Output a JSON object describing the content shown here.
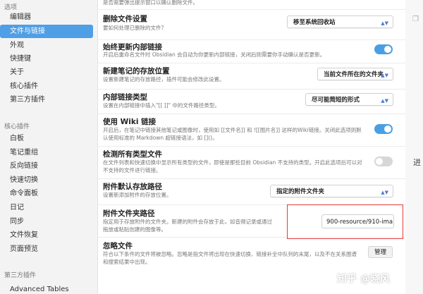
{
  "sidebar": {
    "header_options": "选项",
    "items_options": [
      {
        "label": "编辑器",
        "active": false
      },
      {
        "label": "文件与链接",
        "active": true
      },
      {
        "label": "外观",
        "active": false
      },
      {
        "label": "快捷键",
        "active": false
      },
      {
        "label": "关于",
        "active": false
      },
      {
        "label": "核心插件",
        "active": false
      },
      {
        "label": "第三方插件",
        "active": false
      }
    ],
    "header_core": "核心插件",
    "items_core": [
      "白板",
      "笔记重组",
      "反向链接",
      "快速切换",
      "命令面板",
      "日记",
      "同步",
      "文件恢复",
      "页面预览"
    ],
    "header_third": "第三方插件",
    "items_third": [
      "Advanced Tables"
    ]
  },
  "main": {
    "top_desc": "是否需要弹出提示窗口以确认删除文件。",
    "settings": [
      {
        "title": "删除文件设置",
        "desc": "要如何处理已删除的文件？",
        "control": "select",
        "value": "移至系统回收站"
      },
      {
        "title": "始终更新内部链接",
        "desc": "开启后重命名文件时 Obsidian 会自动为你更新内部链接，关闭后则需要你手动确认是否更新。",
        "control": "toggle",
        "value": "on"
      },
      {
        "title": "新建笔记的存放位置",
        "desc": "设置新建笔记的存放路径，插件可能会修改此设置。",
        "control": "select",
        "value": "当前文件所在的文件夹"
      },
      {
        "title": "内部链接类型",
        "desc": "设置在内部链接中插入\"[[ ]]\" 中的文件路径类型。",
        "control": "select",
        "value": "尽可能简短的形式"
      },
      {
        "title": "使用 Wiki 链接",
        "desc": "开启后，在笔记中链接其他笔记或图像时，使用如 [[文件名]] 和 ![[图片名]] 这样的Wiki链接。关闭此选项则默认使用标准的 Markdown 超链接语法，如 []()。",
        "control": "toggle",
        "value": "on"
      },
      {
        "title": "检测所有类型文件",
        "desc": "在文件列表和快速切换中显示所有类型的文件，即使是那些目前 Obsidian 不支持的类型。开启此选项后可以对不支持的文件进行链接。",
        "control": "toggle",
        "value": "off"
      },
      {
        "title": "附件默认存放路径",
        "desc": "设置新添加附件的存放位置。",
        "control": "select",
        "value": "指定的附件文件夹"
      },
      {
        "title": "附件文件夹路径",
        "desc": "指定用于存放附件的文件夹。新建的附件会存放于此，如音频记录或通过拖放或粘贴创建的图像等。",
        "control": "text",
        "value": "900-resource/910-ima"
      },
      {
        "title": "忽略文件",
        "desc": "符合以下条件的文件将被忽略。忽略是指文件将出现在快速切换、链接补全中队列的末尾，以及不在关系图谱和搜索结果中出现。",
        "control": "button",
        "value": "管理"
      }
    ]
  },
  "gutter": {
    "top_icon": "window-icon",
    "char": "进"
  },
  "watermark": "知乎 @晓风",
  "colors": {
    "accent": "#4f9fe6",
    "toggle_on": "#4a9fe4",
    "highlight_box": "#e23a3a"
  }
}
